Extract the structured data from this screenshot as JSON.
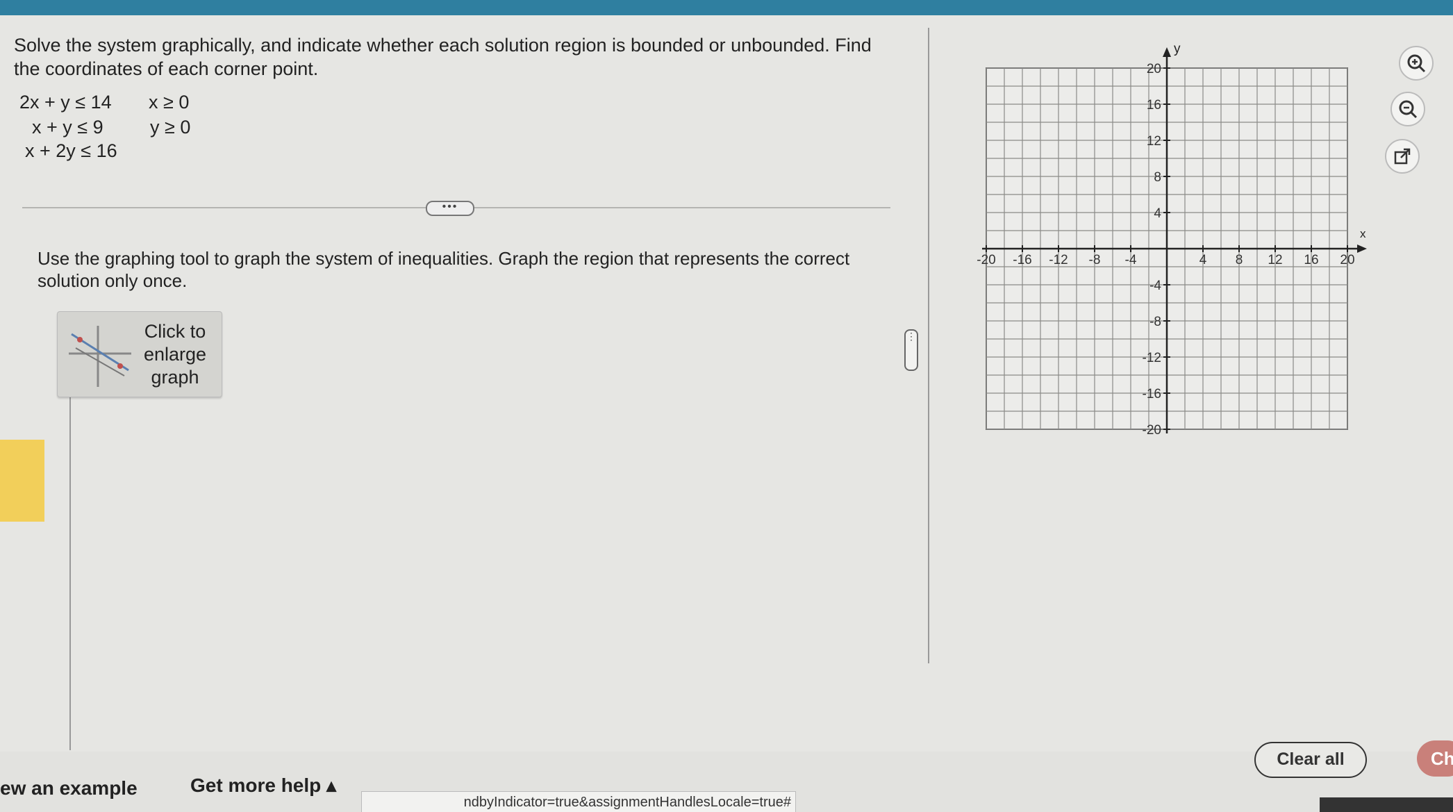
{
  "question": {
    "text": "Solve the system graphically, and indicate whether each solution region is bounded or unbounded. Find the coordinates of each corner point."
  },
  "inequalities": {
    "left": [
      "2x + y ≤ 14",
      "x + y ≤ 9",
      "x + 2y ≤ 16"
    ],
    "right": [
      "x ≥ 0",
      "y ≥ 0"
    ]
  },
  "separator_handle": "•••",
  "instruction": {
    "text": "Use the graphing tool to graph the system of inequalities. Graph the region that represents the correct solution only once."
  },
  "enlarge_button": {
    "label": "Click to enlarge graph"
  },
  "pane_handle": "⋮",
  "graph": {
    "x_label": "x",
    "y_label": "y",
    "x_ticks": [
      "-20",
      "-16",
      "-12",
      "-8",
      "-4",
      "4",
      "8",
      "12",
      "16",
      "20"
    ],
    "y_ticks": [
      "20",
      "16",
      "12",
      "8",
      "4",
      "-4",
      "-8",
      "-12",
      "-16",
      "-20"
    ],
    "x_range": [
      -20,
      20
    ],
    "y_range": [
      -20,
      20
    ],
    "grid_step": 2
  },
  "tools": {
    "zoom_in": "zoom-in-icon",
    "zoom_out": "zoom-out-icon",
    "popout": "external-link-icon"
  },
  "buttons": {
    "clear_all": "Clear all",
    "check": "Ch"
  },
  "footer": {
    "view_example": "ew an example",
    "get_more_help": "Get more help ▴",
    "url_fragment": "ndbyIndicator=true&assignmentHandlesLocale=true#"
  },
  "colors": {
    "top_bar": "#2f7fa0",
    "accent_tab": "#f2cf5a",
    "check_button": "#c9807a"
  }
}
